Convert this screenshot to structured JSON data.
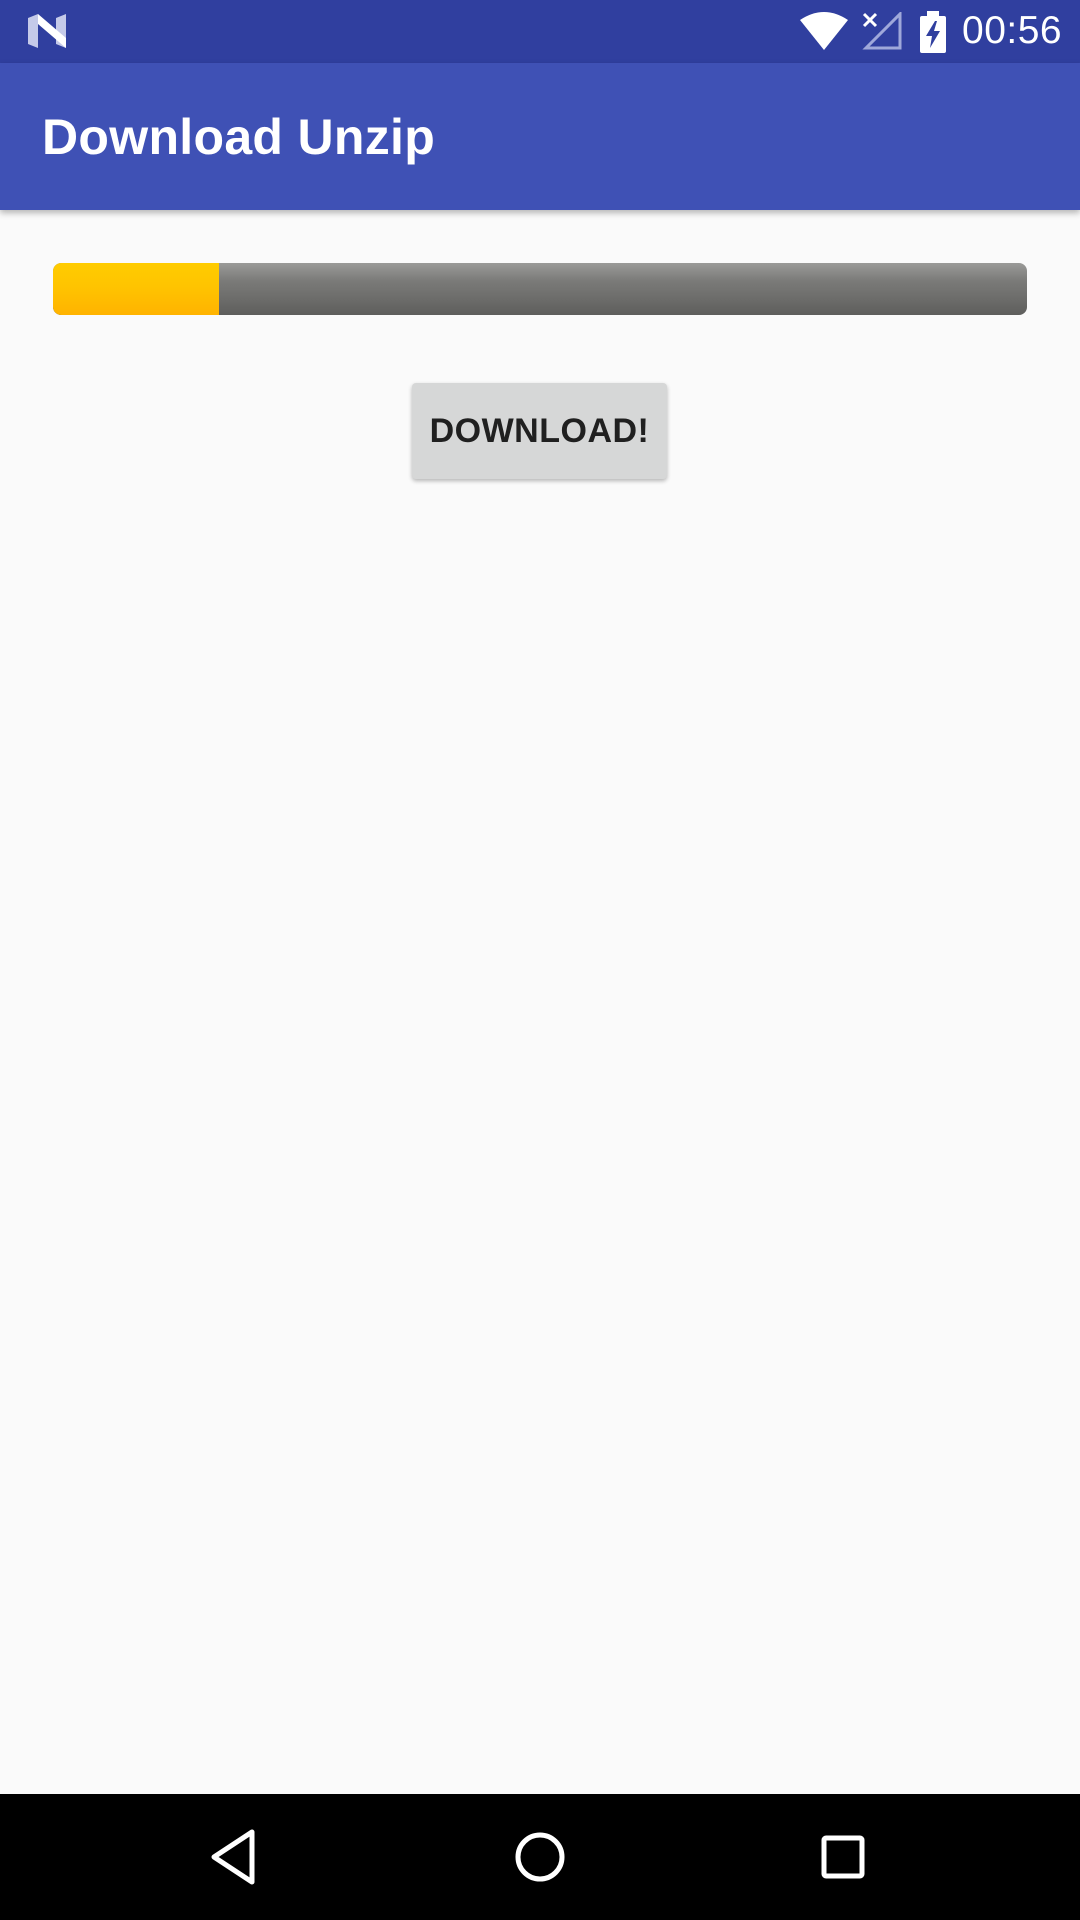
{
  "status_bar": {
    "time": "00:56",
    "icons": [
      "notification-n-icon",
      "wifi-icon",
      "no-signal-icon",
      "battery-charging-icon"
    ]
  },
  "app_bar": {
    "title": "Download Unzip"
  },
  "progress": {
    "value_percent": 17,
    "fill_color": "#ffc107",
    "track_color": "#777776"
  },
  "main": {
    "download_button_label": "DOWNLOAD!"
  },
  "nav_bar": {
    "icons": [
      "back-icon",
      "home-icon",
      "recents-icon"
    ]
  },
  "colors": {
    "status_bar": "#303f9f",
    "app_bar": "#3f51b5",
    "background": "#fafafa"
  }
}
